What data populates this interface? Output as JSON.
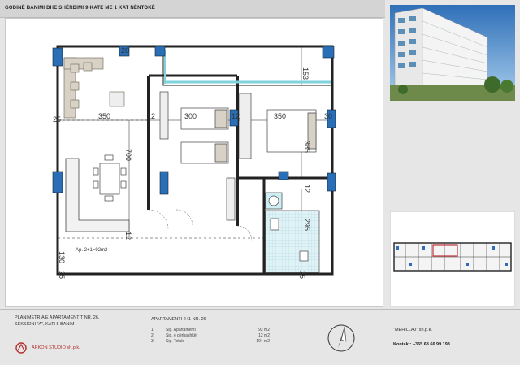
{
  "header": {
    "title": "GODINË BANIMI DHE SHËRBIMI 9-KATE ME 1 KAT NËNTOKË"
  },
  "plan": {
    "dims": {
      "d20": "20",
      "d153": "153",
      "d25_left": "25",
      "d350_left": "350",
      "d12_a": "12",
      "d300": "300",
      "d12_b": "12",
      "d350_right": "350",
      "d30": "30",
      "d385": "385",
      "d700": "700",
      "d12_c": "12",
      "d295": "295",
      "d12_d": "12",
      "d130": "130",
      "d25_bottom": "25",
      "d25_br": "25"
    },
    "area_label": "Ap. 2+1=92m2"
  },
  "footer": {
    "plan_title_1": "PLANIMETRIA E APARTAMENTIT NR. 26,",
    "plan_title_2": "SEKSIONI \"A\", KATI 5 BANIM",
    "apt_title": "APARTAMENTI 2+1 NR. 26",
    "areas": [
      {
        "n": "1.",
        "k": "Sip. Apartamenti",
        "v": "92 m2"
      },
      {
        "n": "2.",
        "k": "Sip. e përbashkët",
        "v": "12 m2"
      },
      {
        "n": "3.",
        "k": "Sip. Totale",
        "v": "104 m2"
      }
    ],
    "studio": "ARKON STUDIO sh.p.k.",
    "company": "\"MEHILLAJ\" sh.p.k.",
    "contact": "Kontakt: +355 68 66 99 198"
  },
  "colors": {
    "window_blue": "#2a6fb5",
    "balcony_cyan": "#7fd3dd",
    "studio_red": "#b3302c"
  }
}
